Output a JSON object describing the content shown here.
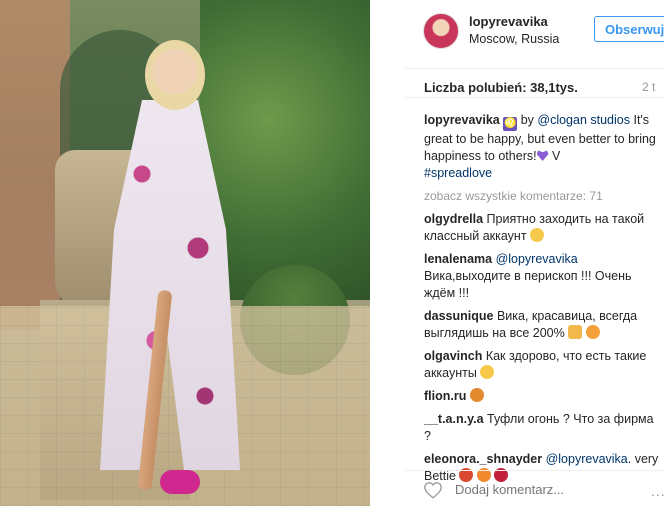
{
  "post": {
    "author": "lopyrevavika",
    "location": "Moscow, Russia",
    "follow_label": "Obserwuj",
    "likes_label": "Liczba polubień: 38,1tys.",
    "age": "2 t",
    "view_all_label": "zobacz wszystkie komentarze: 71",
    "add_comment_placeholder": "Dodaj komentarz...",
    "more_label": "..."
  },
  "caption": {
    "user": "lopyrevavika",
    "zodiac": "♌",
    "by": " by ",
    "mention": "@clogan studios",
    "text": " It's great to be happy, but even better to bring happiness to others!",
    "tail": " V",
    "hashtag": "#spreadlove"
  },
  "comments": [
    {
      "user": "olgydrella",
      "text": " Приятно заходить на такой классный аккаунт"
    },
    {
      "user": "lenalenama",
      "mention": " @lopyrevavika",
      "text": " Вика,выходите в перископ !!! Очень ждём !!!"
    },
    {
      "user": "dassunique",
      "text": " Вика, красавица, всегда выглядишь на все 200%"
    },
    {
      "user": "olgavinch",
      "text": " Как здорово, что есть такие аккаунты"
    },
    {
      "user": "flion.ru",
      "text": " "
    },
    {
      "user": "__t.a.n.y.a",
      "text": " Туфли огонь ? Что за фирма ?"
    },
    {
      "user": "eleonora._shnayder",
      "mention": " @lopyrevavika",
      "text": ". very Bettie "
    }
  ],
  "colors": {
    "accent": "#3897f0",
    "link": "#003569",
    "muted": "#999999"
  }
}
